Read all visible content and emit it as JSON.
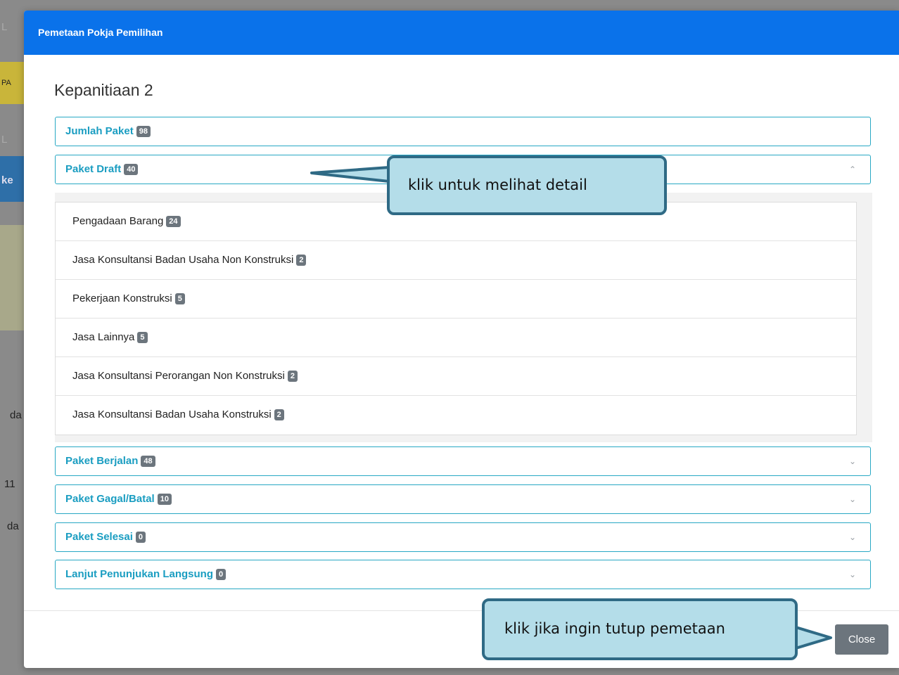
{
  "modal": {
    "title": "Pemetaan Pokja Pemilihan",
    "committee": "Kepanitiaan 2",
    "close_label": "Close"
  },
  "panels": [
    {
      "label": "Jumlah Paket",
      "count": "98"
    },
    {
      "label": "Paket Draft",
      "count": "40",
      "expanded": true
    },
    {
      "label": "Paket Berjalan",
      "count": "48"
    },
    {
      "label": "Paket Gagal/Batal",
      "count": "10"
    },
    {
      "label": "Paket Selesai",
      "count": "0"
    },
    {
      "label": "Lanjut Penunjukan Langsung",
      "count": "0"
    }
  ],
  "draft_items": [
    {
      "label": "Pengadaan Barang",
      "count": "24"
    },
    {
      "label": "Jasa Konsultansi Badan Usaha Non Konstruksi",
      "count": "2"
    },
    {
      "label": "Pekerjaan Konstruksi",
      "count": "5"
    },
    {
      "label": "Jasa Lainnya",
      "count": "5"
    },
    {
      "label": "Jasa Konsultansi Perorangan Non Konstruksi",
      "count": "2"
    },
    {
      "label": "Jasa Konsultansi Badan Usaha Konstruksi",
      "count": "2"
    }
  ],
  "annotations": {
    "detail_hint": "klik untuk melihat detail",
    "close_hint": "klik jika ingin tutup pemetaan"
  },
  "background": {
    "fragments": [
      "L",
      "PA",
      "L",
      "ke",
      "da",
      "11",
      "da"
    ]
  },
  "colors": {
    "header": "#0a72ea",
    "panel_border": "#28a8c4",
    "panel_title": "#1a9dc1",
    "badge": "#6c757d",
    "callout_fill": "#b4dde9",
    "callout_border": "#2f6a85"
  }
}
